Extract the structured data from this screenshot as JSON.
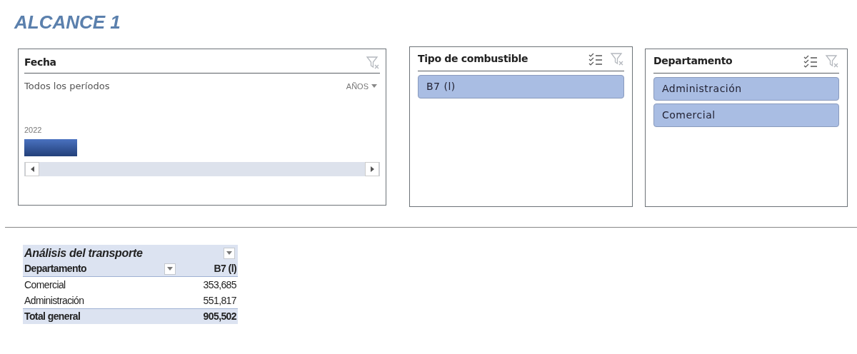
{
  "title": "ALCANCE 1",
  "timeline": {
    "title": "Fecha",
    "period_label": "Todos los períodos",
    "level_selector": "AÑOS",
    "periods": [
      {
        "label": "2022",
        "selected": true
      }
    ]
  },
  "slicers": [
    {
      "title": "Tipo de combustible",
      "items": [
        {
          "label": "B7 (l)",
          "selected": true
        }
      ]
    },
    {
      "title": "Departamento",
      "items": [
        {
          "label": "Administración",
          "selected": true
        },
        {
          "label": "Comercial",
          "selected": true
        }
      ]
    }
  ],
  "pivot": {
    "title": "Análisis del transporte",
    "row_header": "Departamento",
    "column_header": "B7 (l)",
    "rows": [
      {
        "label": "Comercial",
        "value": "353,685"
      },
      {
        "label": "Administración",
        "value": "551,817"
      }
    ],
    "total": {
      "label": "Total general",
      "value": "905,502"
    }
  }
}
